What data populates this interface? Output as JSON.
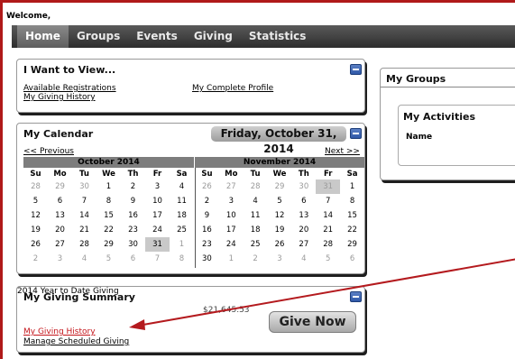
{
  "header": {
    "welcome": "Welcome,"
  },
  "nav": {
    "items": [
      {
        "label": "Home",
        "active": true
      },
      {
        "label": "Groups",
        "active": false
      },
      {
        "label": "Events",
        "active": false
      },
      {
        "label": "Giving",
        "active": false
      },
      {
        "label": "Statistics",
        "active": false
      }
    ]
  },
  "i_want_to_view": {
    "title": "I Want to View...",
    "links": {
      "available_registrations": "Available Registrations",
      "my_complete_profile": "My Complete Profile",
      "my_giving_history": "My Giving History"
    }
  },
  "calendar": {
    "title": "My Calendar",
    "selected_date": "Friday, October 31, 2014",
    "previous": "<< Previous",
    "next": "Next >>",
    "day_headers": [
      "Su",
      "Mo",
      "Tu",
      "We",
      "Th",
      "Fr",
      "Sa"
    ],
    "months": [
      {
        "name": "October 2014",
        "weeks": [
          [
            "28",
            "29",
            "30",
            "1",
            "2",
            "3",
            "4"
          ],
          [
            "5",
            "6",
            "7",
            "8",
            "9",
            "10",
            "11"
          ],
          [
            "12",
            "13",
            "14",
            "15",
            "16",
            "17",
            "18"
          ],
          [
            "19",
            "20",
            "21",
            "22",
            "23",
            "24",
            "25"
          ],
          [
            "26",
            "27",
            "28",
            "29",
            "30",
            "31",
            "1"
          ],
          [
            "2",
            "3",
            "4",
            "5",
            "6",
            "7",
            "8"
          ]
        ],
        "other_month": [
          [
            0,
            0
          ],
          [
            0,
            1
          ],
          [
            0,
            2
          ],
          [
            4,
            6
          ],
          [
            5,
            0
          ],
          [
            5,
            1
          ],
          [
            5,
            2
          ],
          [
            5,
            3
          ],
          [
            5,
            4
          ],
          [
            5,
            5
          ],
          [
            5,
            6
          ]
        ],
        "selected": [
          4,
          5
        ]
      },
      {
        "name": "November 2014",
        "weeks": [
          [
            "26",
            "27",
            "28",
            "29",
            "30",
            "31",
            "1"
          ],
          [
            "2",
            "3",
            "4",
            "5",
            "6",
            "7",
            "8"
          ],
          [
            "9",
            "10",
            "11",
            "12",
            "13",
            "14",
            "15"
          ],
          [
            "16",
            "17",
            "18",
            "19",
            "20",
            "21",
            "22"
          ],
          [
            "23",
            "24",
            "25",
            "26",
            "27",
            "28",
            "29"
          ],
          [
            "30",
            "1",
            "2",
            "3",
            "4",
            "5",
            "6"
          ]
        ],
        "other_month": [
          [
            0,
            0
          ],
          [
            0,
            1
          ],
          [
            0,
            2
          ],
          [
            0,
            3
          ],
          [
            0,
            4
          ],
          [
            0,
            5
          ],
          [
            5,
            1
          ],
          [
            5,
            2
          ],
          [
            5,
            3
          ],
          [
            5,
            4
          ],
          [
            5,
            5
          ],
          [
            5,
            6
          ]
        ],
        "selected": [
          0,
          5
        ]
      }
    ]
  },
  "giving_summary": {
    "title": "My Giving Summary",
    "ytd_label": "2014 Year to Date Giving",
    "ytd_amount": "$21,645.53",
    "my_giving_history": "My Giving History",
    "manage_scheduled": "Manage Scheduled Giving",
    "give_now": "Give Now"
  },
  "my_groups": {
    "title": "My Groups",
    "activities_title": "My Activities",
    "name_header": "Name"
  },
  "colors": {
    "frame_border": "#b01a1a",
    "arrow": "#b41a1e",
    "nav_bg": "#3c3c3c",
    "link_red": "#c4141a"
  }
}
